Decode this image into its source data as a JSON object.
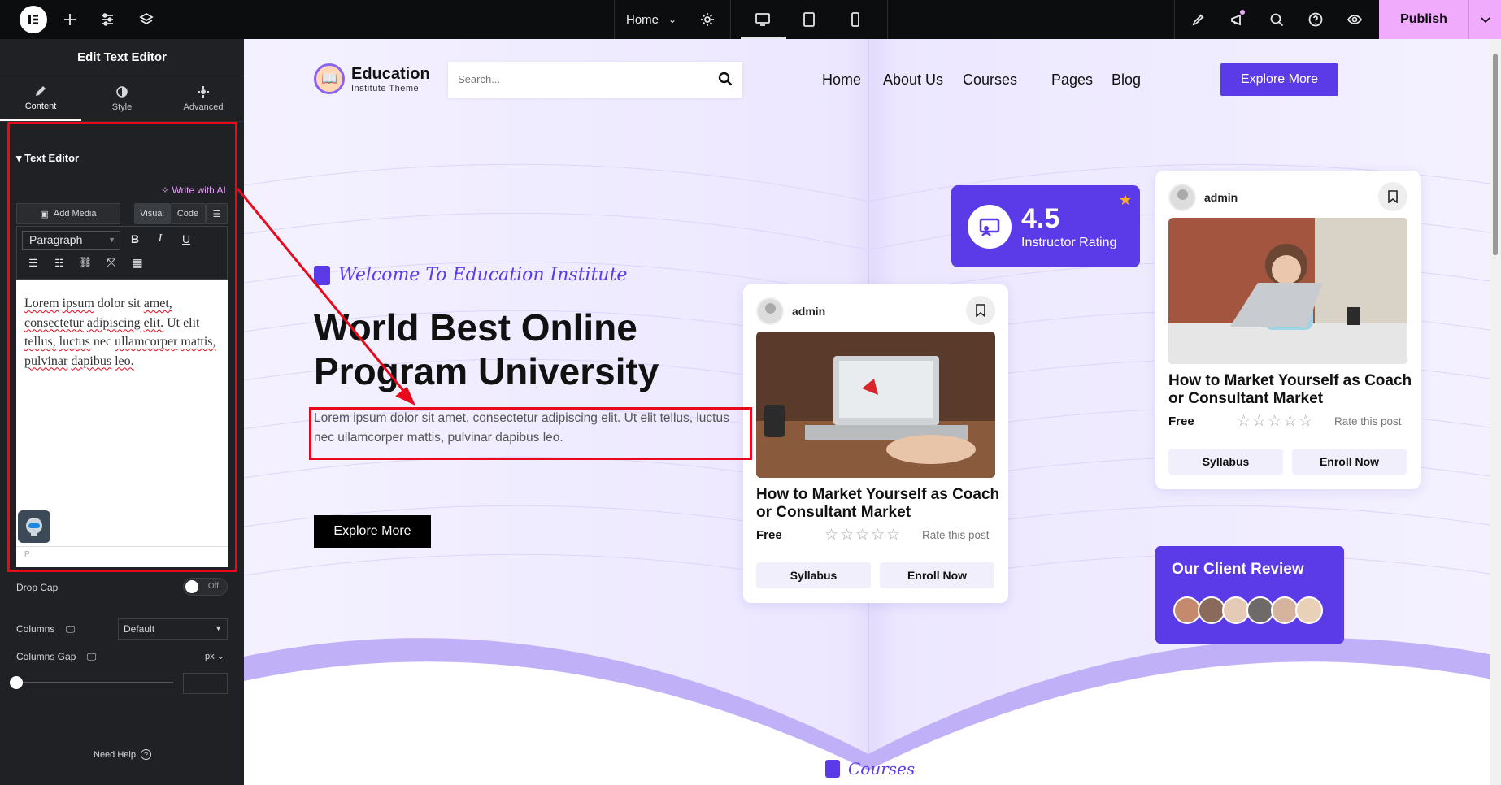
{
  "topbar": {
    "document_title": "Home",
    "publish_label": "Publish"
  },
  "panel": {
    "title": "Edit Text Editor",
    "tabs": [
      {
        "label": "Content"
      },
      {
        "label": "Style"
      },
      {
        "label": "Advanced"
      }
    ],
    "section_title": "Text Editor",
    "write_ai": "Write with AI",
    "add_media": "Add Media",
    "visual_tab": "Visual",
    "code_tab": "Code",
    "format_select": "Paragraph",
    "editor_words": [
      "Lorem",
      "ipsum",
      "dolor",
      "sit",
      "amet,",
      "consectetur",
      "adipiscing",
      "elit.",
      "Ut",
      "elit",
      "tellus,",
      "luctus",
      "nec",
      "ullamcorper",
      "mattis,",
      "pulvinar",
      "dapibus",
      "leo."
    ],
    "path_indicator": "P",
    "drop_cap_label": "Drop Cap",
    "drop_cap_state": "Off",
    "columns_label": "Columns",
    "columns_value": "Default",
    "columns_gap_label": "Columns Gap",
    "columns_gap_unit": "px",
    "need_help": "Need Help"
  },
  "site": {
    "brand_name": "Education",
    "brand_sub": "Institute Theme",
    "search_placeholder": "Search...",
    "nav": [
      "Home",
      "About Us",
      "Courses",
      "Pages",
      "Blog"
    ],
    "header_cta": "Explore More",
    "welcome": "Welcome To Education Institute",
    "hero_title_line1": "World Best Online",
    "hero_title_line2": "Program University",
    "hero_text": "Lorem ipsum dolor sit amet, consectetur adipiscing elit. Ut elit tellus, luctus nec ullamcorper mattis, pulvinar dapibus leo.",
    "hero_cta": "Explore More",
    "rating_value": "4.5",
    "rating_caption": "Instructor Rating",
    "cards": [
      {
        "user": "admin",
        "title": "How to Market Yourself as Coach or Consultant Market",
        "price": "Free",
        "rate_label": "Rate this post",
        "btn1": "Syllabus",
        "btn2": "Enroll Now"
      },
      {
        "user": "admin",
        "title": "How to Market Yourself as Coach or Consultant Market",
        "price": "Free",
        "rate_label": "Rate this post",
        "btn1": "Syllabus",
        "btn2": "Enroll Now"
      }
    ],
    "review_title": "Our Client Review",
    "courses_label": "Courses"
  },
  "colors": {
    "accent": "#5b3be8",
    "publish": "#f0abfc",
    "highlight": "#e8091a",
    "panel_bg": "#1f2124"
  }
}
